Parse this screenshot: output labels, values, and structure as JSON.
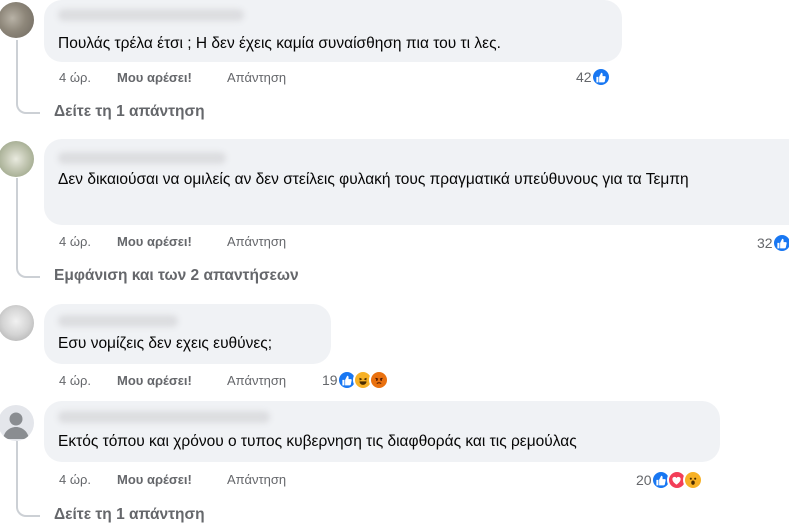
{
  "comments": [
    {
      "text": "Πουλάς τρέλα έτσι ; Η δεν έχεις καμία συναίσθηση πια του τι λες.",
      "time": "4 ώρ.",
      "like_label": "Μου αρέσει!",
      "reply_label": "Απάντηση",
      "reaction_count": "42",
      "reactions": [
        "like-icon"
      ],
      "replies_link": "Δείτε τη 1 απάντηση"
    },
    {
      "text": "Δεν δικαιούσαι να ομιλείς αν δεν στείλεις φυλακή τους πραγματικά υπεύθυνους για τα Τεμπη",
      "time": "4 ώρ.",
      "like_label": "Μου αρέσει!",
      "reply_label": "Απάντηση",
      "reaction_count": "32",
      "reactions": [
        "like-icon"
      ],
      "replies_link": "Εμφάνιση και των 2 απαντήσεων"
    },
    {
      "text": "Εσυ νομίζεις δεν εχεις ευθύνες;",
      "time": "4 ώρ.",
      "like_label": "Μου αρέσει!",
      "reply_label": "Απάντηση",
      "reaction_count": "19",
      "reactions": [
        "like-icon",
        "haha-icon",
        "angry-icon"
      ]
    },
    {
      "text": "Εκτός τόπου και χρόνου ο τυπος κυβερνηση τις διαφθοράς και τις ρεμούλας",
      "time": "4 ώρ.",
      "like_label": "Μου αρέσει!",
      "reply_label": "Απάντηση",
      "reaction_count": "20",
      "reactions": [
        "like-icon",
        "love-icon",
        "wow-icon"
      ],
      "replies_link": "Δείτε τη 1 απάντηση"
    }
  ],
  "colors": {
    "bubble": "#f0f2f5",
    "meta_text": "#65676b",
    "like_blue": "#1877f2",
    "thread_line": "#ccd0d5"
  }
}
